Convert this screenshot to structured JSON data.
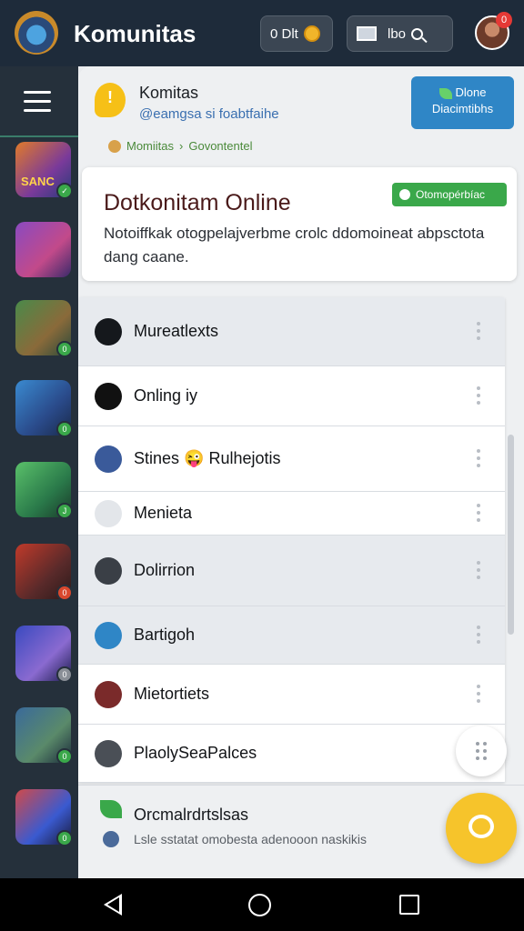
{
  "app": {
    "title": "Komunitas",
    "logo_icon": "app-logo-icon"
  },
  "topbar": {
    "online_button": {
      "label": "0 Dlt",
      "icon": "coin-icon"
    },
    "inbox_button": {
      "label": "lbo",
      "icons": [
        "mail-icon",
        "search-icon"
      ]
    },
    "notification_count": "0",
    "avatar_icon": "user-avatar"
  },
  "rail": {
    "menu_icon": "hamburger-menu-icon",
    "games": [
      {
        "name": "game-1",
        "art_text": "SANC",
        "tag": "✓",
        "tag_color": "#3aa84a"
      },
      {
        "name": "game-2",
        "tag": "",
        "tag_color": ""
      },
      {
        "name": "game-3",
        "tag": "0",
        "tag_color": "#3aa84a"
      },
      {
        "name": "game-4",
        "tag": "0",
        "tag_color": "#3aa84a"
      },
      {
        "name": "game-5",
        "tag": "J",
        "tag_color": "#3aa84a"
      },
      {
        "name": "game-6",
        "tag": "0",
        "tag_color": "#d9482e"
      },
      {
        "name": "game-7",
        "tag": "0",
        "tag_color": "#8a8f97"
      },
      {
        "name": "game-8",
        "tag": "0",
        "tag_color": "#3aa84a"
      },
      {
        "name": "game-9",
        "tag": "0",
        "tag_color": "#3aa84a"
      }
    ]
  },
  "header": {
    "title": "Komitas",
    "subtitle": "@eamgsa si foabtfaihe",
    "action_label": "Dlone Diacimtibhs",
    "breadcrumb": [
      "Momiitas",
      "›",
      "Govontentel"
    ]
  },
  "card": {
    "title": "Dotkonitam Online",
    "badge": "Otomopérbíac",
    "body": "Notoiffkak otogpelajverbme crolc ddomoineat abpsctota dang caane."
  },
  "list": {
    "rows": [
      {
        "label": "Mureatlexts",
        "icon": "circle-dots-icon",
        "shaded": true
      },
      {
        "label": "Onling iy",
        "icon": "lightning-icon",
        "shaded": false
      },
      {
        "label": "Stines 😜 Rulhejotis",
        "icon": "game-thumb-icon",
        "shaded": false
      },
      {
        "label": "Menieta",
        "icon": "dots-icon",
        "shaded": false
      },
      {
        "label": "Dolirrion",
        "icon": "helmet-avatar-icon",
        "shaded": true
      },
      {
        "label": "Bartigoh",
        "icon": "lightning-blue-icon",
        "shaded": true
      },
      {
        "label": "Mietortiets",
        "icon": "warrior-avatar-icon",
        "shaded": false
      },
      {
        "label": "PlaolySeaPalces",
        "icon": "knight-avatar-icon",
        "shaded": false
      }
    ]
  },
  "bottom_card": {
    "title": "Orcmalrdrtslsas",
    "subtitle": "Lsle sstatat omobesta adenooon naskikis"
  },
  "fab": {
    "primary_icon": "chat-icon",
    "secondary_icon": "grid-dots-icon",
    "primary_color": "#f6c42b"
  },
  "navbar": {
    "icons": [
      "back-icon",
      "home-icon",
      "recents-icon"
    ]
  },
  "colors": {
    "topbar": "#1e2b3a",
    "rail": "#25303b",
    "accent_green": "#3aa84a",
    "accent_blue": "#2f86c6"
  }
}
